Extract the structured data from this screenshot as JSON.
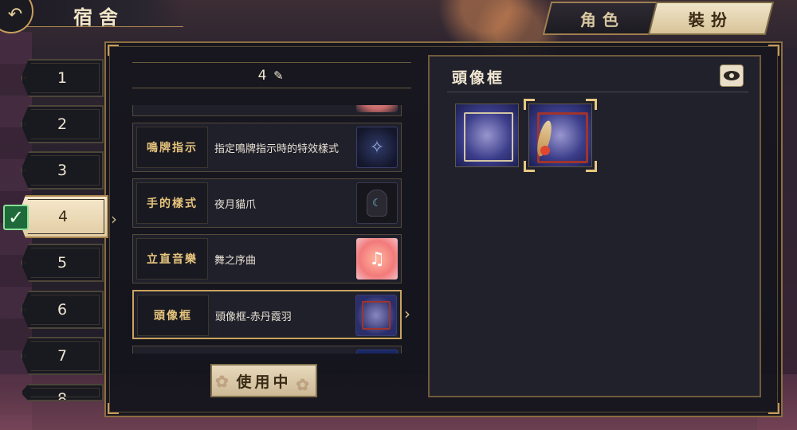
{
  "header": {
    "title": "宿舍"
  },
  "tabs": [
    {
      "label": "角色",
      "active": false
    },
    {
      "label": "裝扮",
      "active": true
    }
  ],
  "slots": [
    "1",
    "2",
    "3",
    "4",
    "5",
    "6",
    "7",
    "8"
  ],
  "active_slot": "4",
  "list": {
    "header_number": "4",
    "rows": [
      {
        "label": "鳴牌指示",
        "value": "指定鳴牌指示時的特效樣式",
        "thumb_icon": "effect-icon"
      },
      {
        "label": "手的樣式",
        "value": "夜月貓爪",
        "thumb_icon": "cat-paw-icon"
      },
      {
        "label": "立直音樂",
        "value": "舞之序曲",
        "thumb_icon": "music-note-icon"
      },
      {
        "label": "頭像框",
        "value": "頭像框-赤丹霞羽",
        "thumb_icon": "avatar-frame-icon"
      }
    ],
    "selected_row": 3
  },
  "use_button": {
    "label": "使用中"
  },
  "right_panel": {
    "title": "頭像框",
    "frames": [
      {
        "name": "default-frame",
        "selected": false
      },
      {
        "name": "crimson-feather-frame",
        "selected": true
      }
    ]
  },
  "colors": {
    "accent_gold": "#c9a45f",
    "label_gold": "#e6c47c",
    "check_green": "#1f6a3a",
    "tab_active_bg": "#f0e4c8"
  }
}
